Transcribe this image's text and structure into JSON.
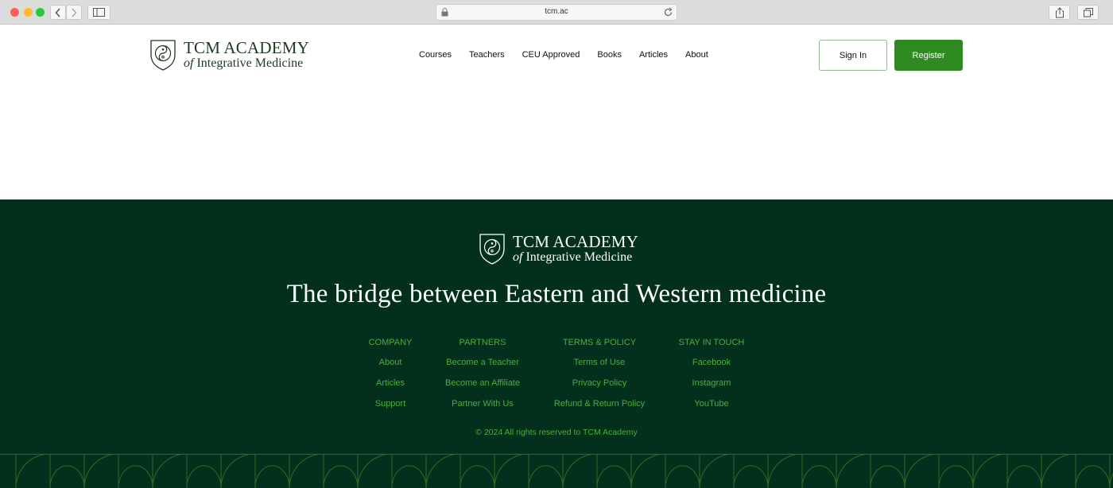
{
  "browser": {
    "url": "tcm.ac"
  },
  "header": {
    "logo": {
      "line1": "TCM ACADEMY",
      "line2_prefix": "of",
      "line2_rest": " Integrative Medicine"
    },
    "nav": [
      "Courses",
      "Teachers",
      "CEU Approved",
      "Books",
      "Articles",
      "About"
    ],
    "sign_in": "Sign In",
    "register": "Register"
  },
  "footer": {
    "logo": {
      "line1": "TCM ACADEMY",
      "line2_prefix": "of",
      "line2_rest": " Integrative Medicine"
    },
    "tagline": "The bridge between Eastern and Western medicine",
    "columns": [
      {
        "heading": "COMPANY",
        "links": [
          "About",
          "Articles",
          "Support"
        ]
      },
      {
        "heading": "PARTNERS",
        "links": [
          "Become a Teacher",
          "Become an Affiliate",
          "Partner With Us"
        ]
      },
      {
        "heading": "TERMS & POLICY",
        "links": [
          "Terms of Use",
          "Privacy Policy",
          "Refund & Return Policy"
        ]
      },
      {
        "heading": "STAY IN TOUCH",
        "links": [
          "Facebook",
          "Instagram",
          "YouTube"
        ]
      }
    ],
    "copyright": "© 2024 All rights reserved to TCM Academy"
  },
  "colors": {
    "brand_green": "#2f8a21",
    "footer_bg": "#02301c",
    "footer_link": "#4caf3c",
    "logo_dark": "#1d3a1f"
  }
}
